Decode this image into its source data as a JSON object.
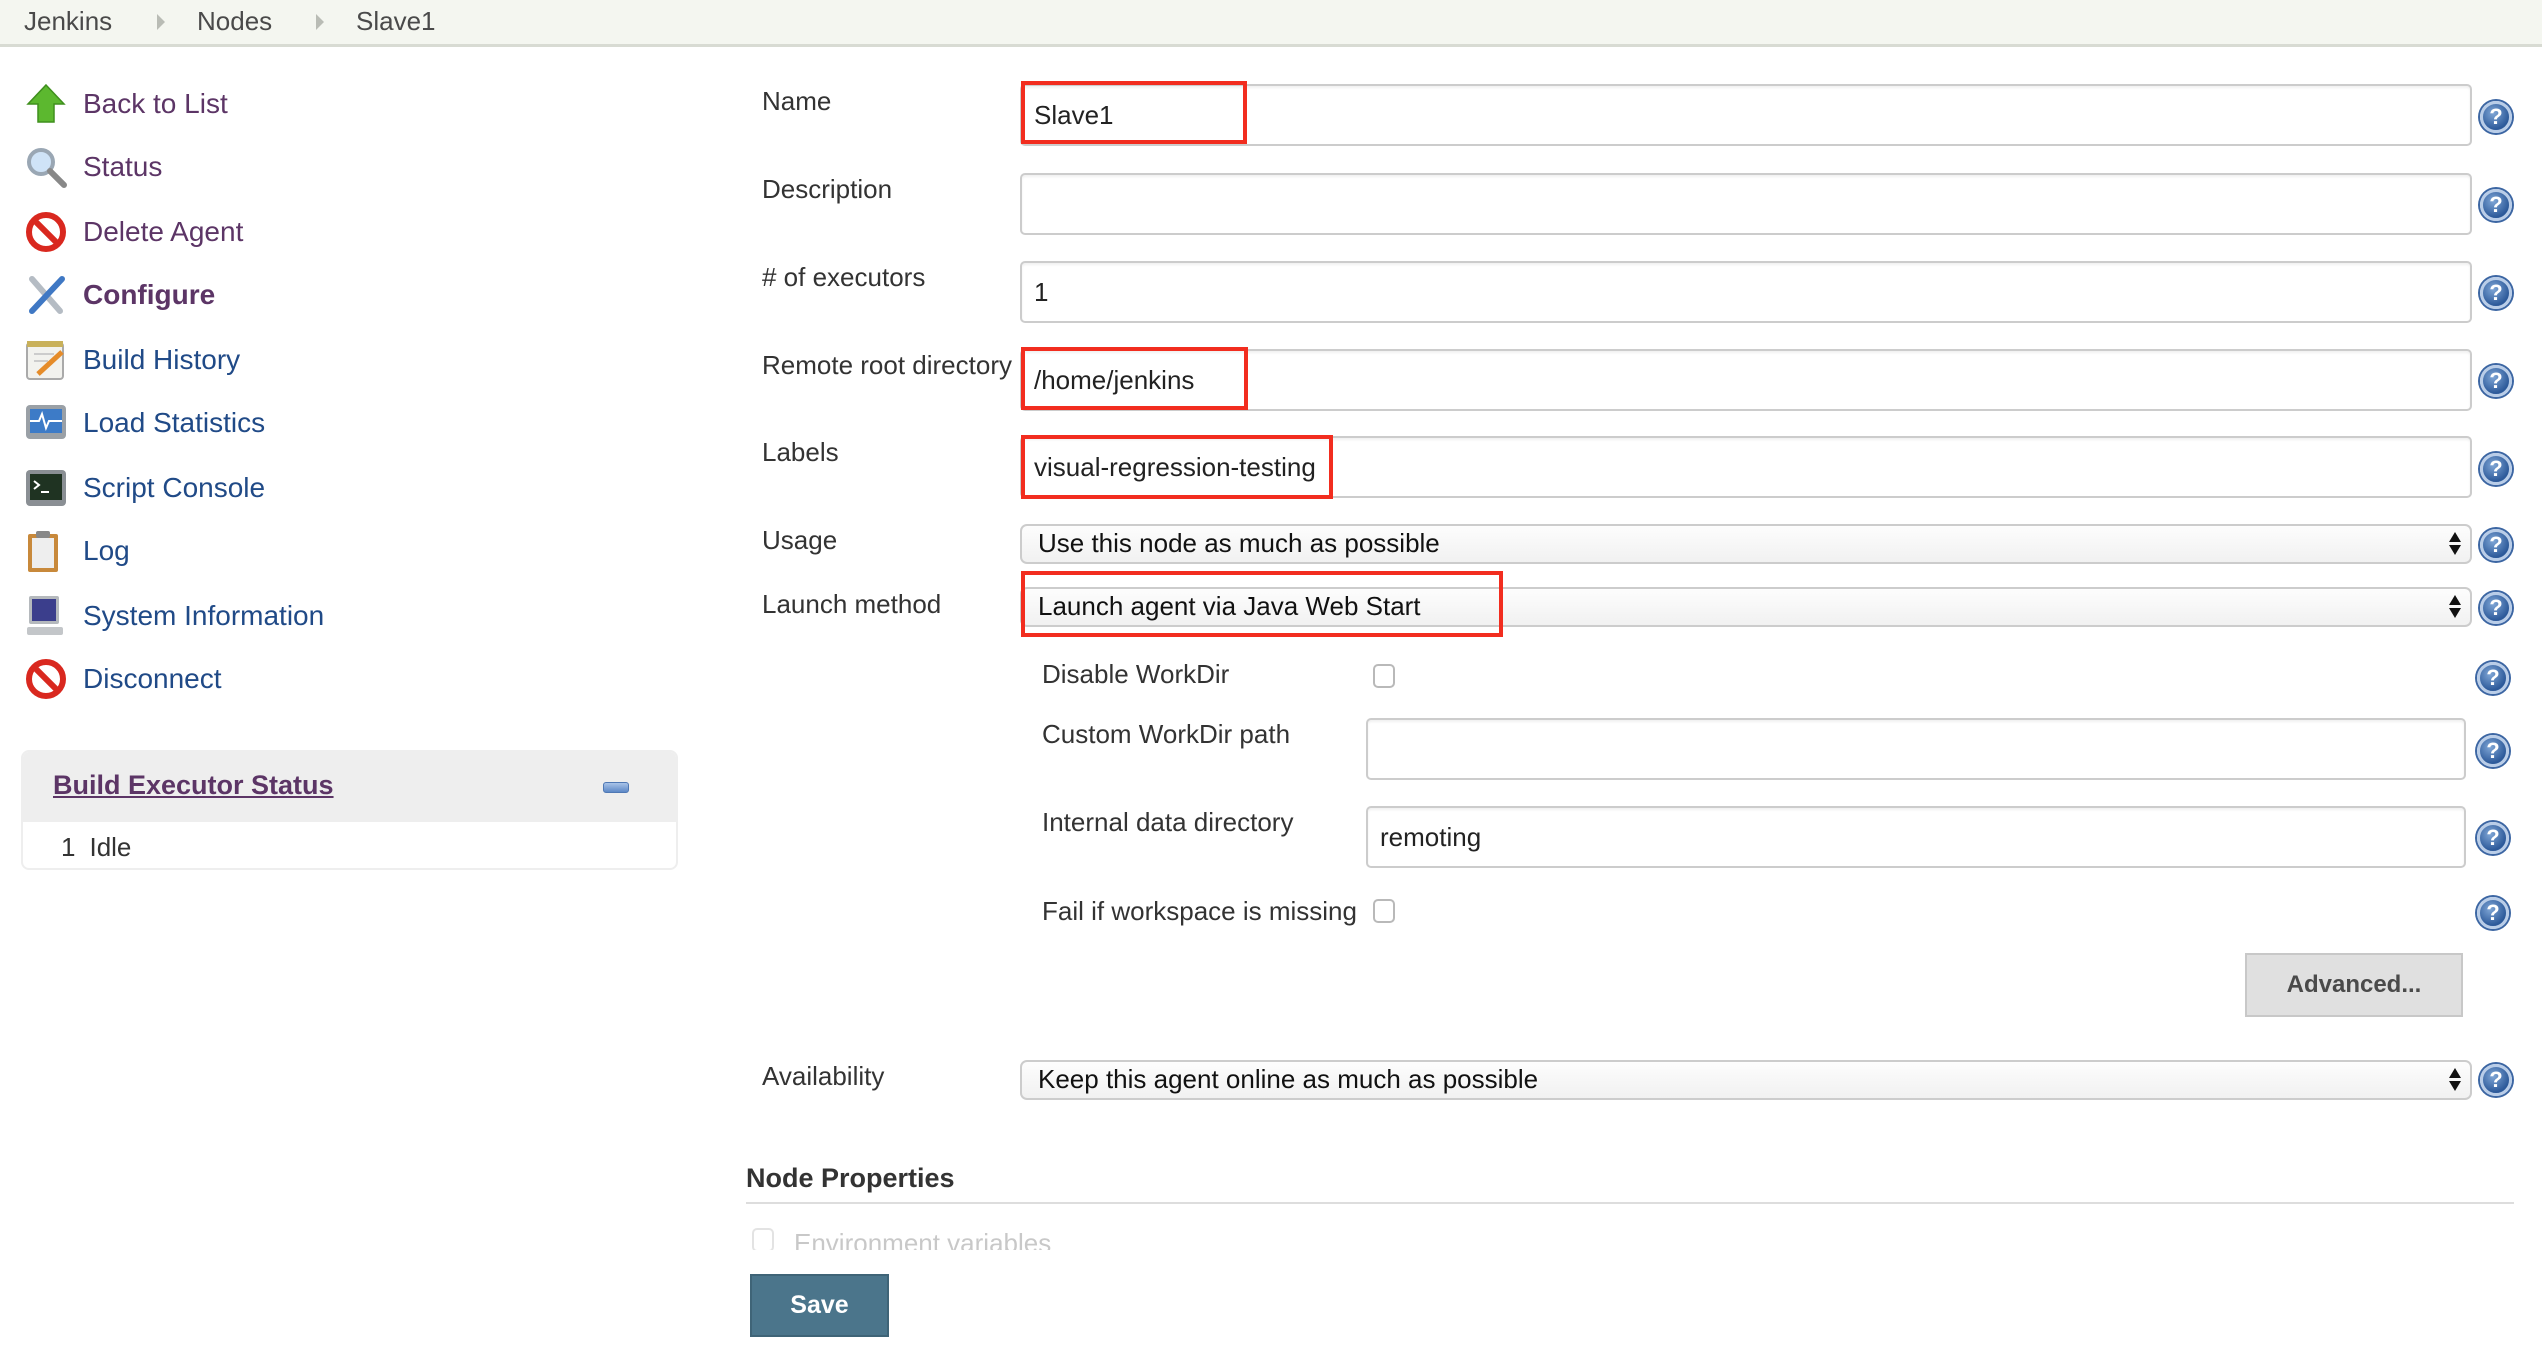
{
  "breadcrumb": [
    "Jenkins",
    "Nodes",
    "Slave1"
  ],
  "sidebar": {
    "items": [
      {
        "label": "Back to List",
        "icon": "up-arrow-icon"
      },
      {
        "label": "Status",
        "icon": "magnifier-icon"
      },
      {
        "label": "Delete Agent",
        "icon": "no-entry-icon"
      },
      {
        "label": "Configure",
        "icon": "wrench-screwdriver-icon"
      },
      {
        "label": "Build History",
        "icon": "notepad-icon"
      },
      {
        "label": "Load Statistics",
        "icon": "monitor-pulse-icon"
      },
      {
        "label": "Script Console",
        "icon": "terminal-icon"
      },
      {
        "label": "Log",
        "icon": "clipboard-icon"
      },
      {
        "label": "System Information",
        "icon": "computer-icon"
      },
      {
        "label": "Disconnect",
        "icon": "no-entry-icon"
      }
    ],
    "executor_status": {
      "title": "Build Executor Status",
      "rows": [
        {
          "number": "1",
          "state": "Idle"
        }
      ]
    }
  },
  "form": {
    "name": {
      "label": "Name",
      "value": "Slave1"
    },
    "description": {
      "label": "Description",
      "value": ""
    },
    "executors": {
      "label": "# of executors",
      "value": "1"
    },
    "remote_root": {
      "label": "Remote root directory",
      "value": "/home/jenkins"
    },
    "labels": {
      "label": "Labels",
      "value": "visual-regression-testing"
    },
    "usage": {
      "label": "Usage",
      "value": "Use this node as much as possible"
    },
    "launch_method": {
      "label": "Launch method",
      "value": "Launch agent via Java Web Start"
    },
    "disable_workdir": {
      "label": "Disable WorkDir",
      "checked": false
    },
    "custom_workdir": {
      "label": "Custom WorkDir path",
      "value": ""
    },
    "internal_data_dir": {
      "label": "Internal data directory",
      "value": "remoting"
    },
    "fail_if_missing": {
      "label": "Fail if workspace is missing",
      "checked": false
    },
    "advanced_label": "Advanced...",
    "availability": {
      "label": "Availability",
      "value": "Keep this agent online as much as possible"
    },
    "node_properties": {
      "title": "Node Properties",
      "env_variables_label": "Environment variables"
    },
    "save_label": "Save",
    "help_symbol": "?"
  },
  "colors": {
    "highlight_box": "#f22d1f",
    "link": "#204a87",
    "visited_link": "#5c3566",
    "save_button": "#4b758b"
  }
}
